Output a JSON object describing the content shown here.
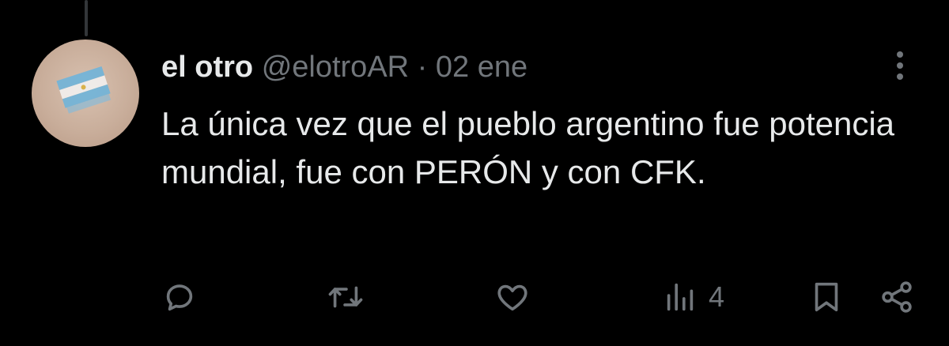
{
  "tweet": {
    "author_name": "el otro",
    "author_handle": "@elotroAR",
    "separator": "·",
    "date": "02 ene",
    "text": "La única vez que el pueblo argentino fue potencia mundial, fue con PERÓN y con CFK."
  },
  "avatar": {
    "description_icon": "argentina-flag-tattoo-icon"
  },
  "actions": {
    "reply_icon": "reply-icon",
    "retweet_icon": "retweet-icon",
    "like_icon": "heart-icon",
    "views_icon": "views-chart-icon",
    "views_count": "4",
    "bookmark_icon": "bookmark-icon",
    "share_icon": "share-icon"
  },
  "colors": {
    "background": "#000000",
    "primary_text": "#e7e9ea",
    "secondary_text": "#71767b",
    "thread_line": "#333639"
  }
}
